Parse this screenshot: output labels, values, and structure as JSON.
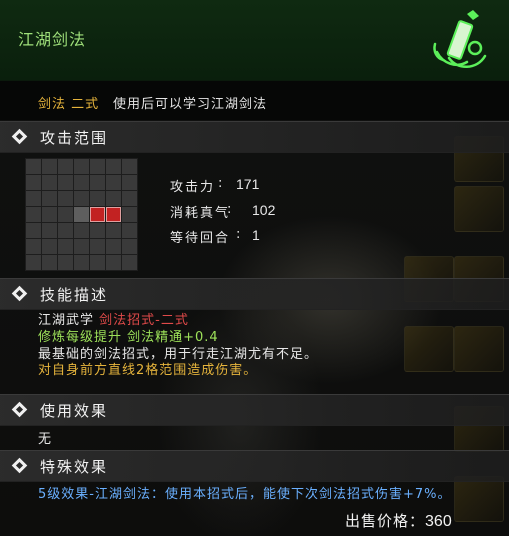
{
  "window": {
    "title": "江湖剑法"
  },
  "item": {
    "type_label": "剑法 二式",
    "description": "使用后可以学习江湖剑法"
  },
  "attack_range": {
    "header": "攻击范围",
    "grid_size": 7,
    "self_cell": [
      3,
      3
    ],
    "hit_cells": [
      [
        3,
        4
      ],
      [
        3,
        5
      ]
    ]
  },
  "stats": [
    {
      "label": "攻击力",
      "value": "171"
    },
    {
      "label": "消耗真气",
      "value": "102"
    },
    {
      "label": "等待回合",
      "value": "1"
    }
  ],
  "skill_desc": {
    "header": "技能描述",
    "line1_prefix": "江湖武学 ",
    "line1_highlight": "剑法招式-二式",
    "line2_prefix": "修炼每级提升 剑法精通",
    "line2_value": "+0.4",
    "line3": "最基础的剑法招式，用于行走江湖尤有不足。",
    "line4": "对自身前方直线2格范围造成伤害。"
  },
  "use_effect": {
    "header": "使用效果",
    "text": "无"
  },
  "special_effect": {
    "header": "特殊效果",
    "text": "5级效果-江湖剑法：使用本招式后，能使下次剑法招式伤害+7%。"
  },
  "price": {
    "label": "出售价格：",
    "value": "360"
  },
  "icons": {
    "emblem": "sword-scroll-emblem-icon",
    "section_marker": "diamond-icon"
  },
  "colors": {
    "title": "#9fe07a",
    "gold": "#e6b43c",
    "red": "#e04a4a",
    "green": "#9ee25a",
    "blue": "#6ab0ff"
  }
}
